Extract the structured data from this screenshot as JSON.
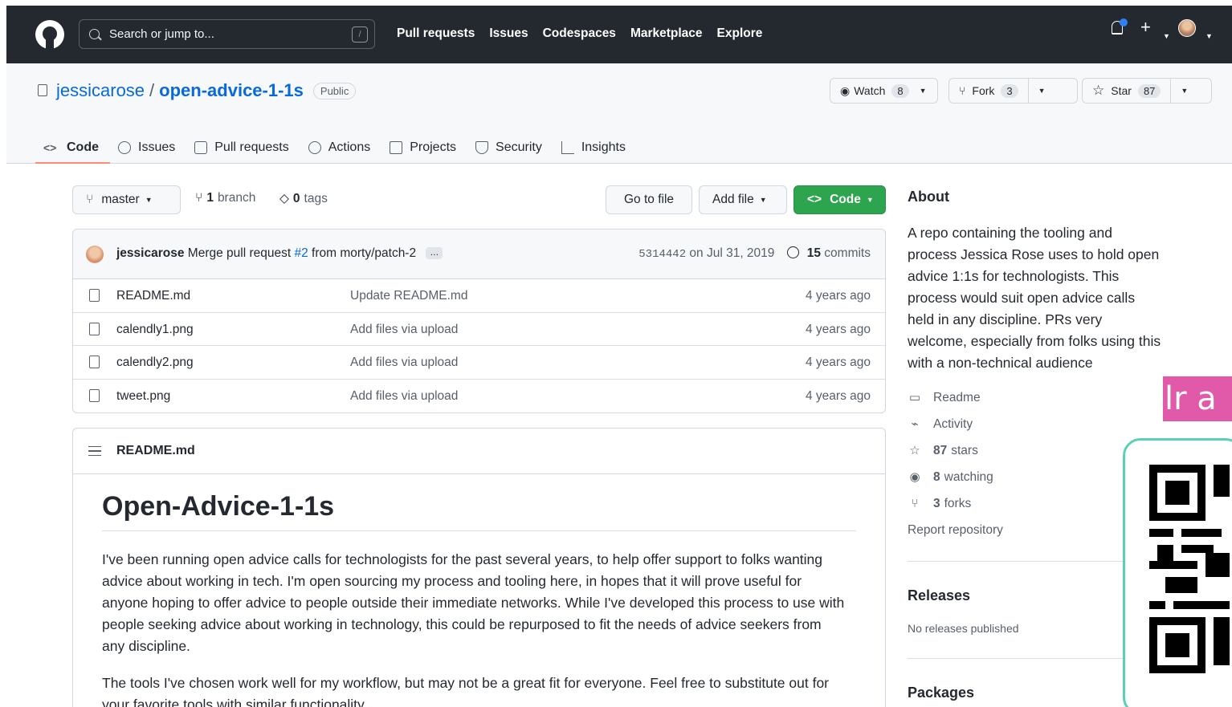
{
  "header": {
    "search_placeholder": "Search or jump to...",
    "slash_key": "/",
    "nav": [
      "Pull requests",
      "Issues",
      "Codespaces",
      "Marketplace",
      "Explore"
    ]
  },
  "repo": {
    "owner": "jessicarose",
    "separator": "/",
    "name": "open-advice-1-1s",
    "visibility": "Public",
    "watch_label": "Watch",
    "watch_count": "8",
    "fork_label": "Fork",
    "fork_count": "3",
    "star_label": "Star",
    "star_count": "87"
  },
  "tabs": [
    "Code",
    "Issues",
    "Pull requests",
    "Actions",
    "Projects",
    "Security",
    "Insights"
  ],
  "toolbar": {
    "branch": "master",
    "branch_count": "1",
    "branch_word": "branch",
    "tag_count": "0",
    "tag_word": "tags",
    "goto_file": "Go to file",
    "add_file": "Add file",
    "code": "Code"
  },
  "commit": {
    "author": "jessicarose",
    "message_pre": "Merge pull request",
    "pr": "#2",
    "message_post": "from morty/patch-2",
    "ellipsis": "…",
    "sha": "5314442",
    "date": "on Jul 31, 2019",
    "commit_count": "15",
    "commit_word": "commits"
  },
  "files": [
    {
      "name": "README.md",
      "message": "Update README.md",
      "age": "4 years ago"
    },
    {
      "name": "calendly1.png",
      "message": "Add files via upload",
      "age": "4 years ago"
    },
    {
      "name": "calendly2.png",
      "message": "Add files via upload",
      "age": "4 years ago"
    },
    {
      "name": "tweet.png",
      "message": "Add files via upload",
      "age": "4 years ago"
    }
  ],
  "readme": {
    "filename": "README.md",
    "title": "Open-Advice-1-1s",
    "p1": "I've been running open advice calls for technologists for the past several years, to help offer support to folks wanting advice about working in tech. I'm open sourcing my process and tooling here, in hopes that it will prove useful for anyone hoping to offer advice to people outside their immediate networks. While I've developed this process to use with people seeking advice about working in technology, this could be repurposed to fit the needs of advice seekers from any discipline.",
    "p2": "The tools I've chosen work well for my workflow, but may not be a great fit for everyone. Feel free to substitute out for your favorite tools with similar functionality."
  },
  "about": {
    "title": "About",
    "description": "A repo containing the tooling and process Jessica Rose uses to hold open advice 1:1s for technologists. This process would suit open advice calls held in any discipline. PRs very welcome, especially from folks using this with a non-technical audience",
    "readme": "Readme",
    "activity": "Activity",
    "stars_num": "87",
    "stars_word": "stars",
    "watching_num": "8",
    "watching_word": "watching",
    "forks_num": "3",
    "forks_word": "forks",
    "report": "Report repository"
  },
  "releases": {
    "title": "Releases",
    "none": "No releases published"
  },
  "packages": {
    "title": "Packages"
  },
  "overlay": {
    "pink_text": "lr a"
  },
  "colors": {
    "header_bg": "#24292f",
    "link": "#0969da",
    "green": "#2da44e",
    "tab_underline": "#fd8c73",
    "pink": "#e05aa9",
    "qr_border": "#5ccfb8"
  }
}
